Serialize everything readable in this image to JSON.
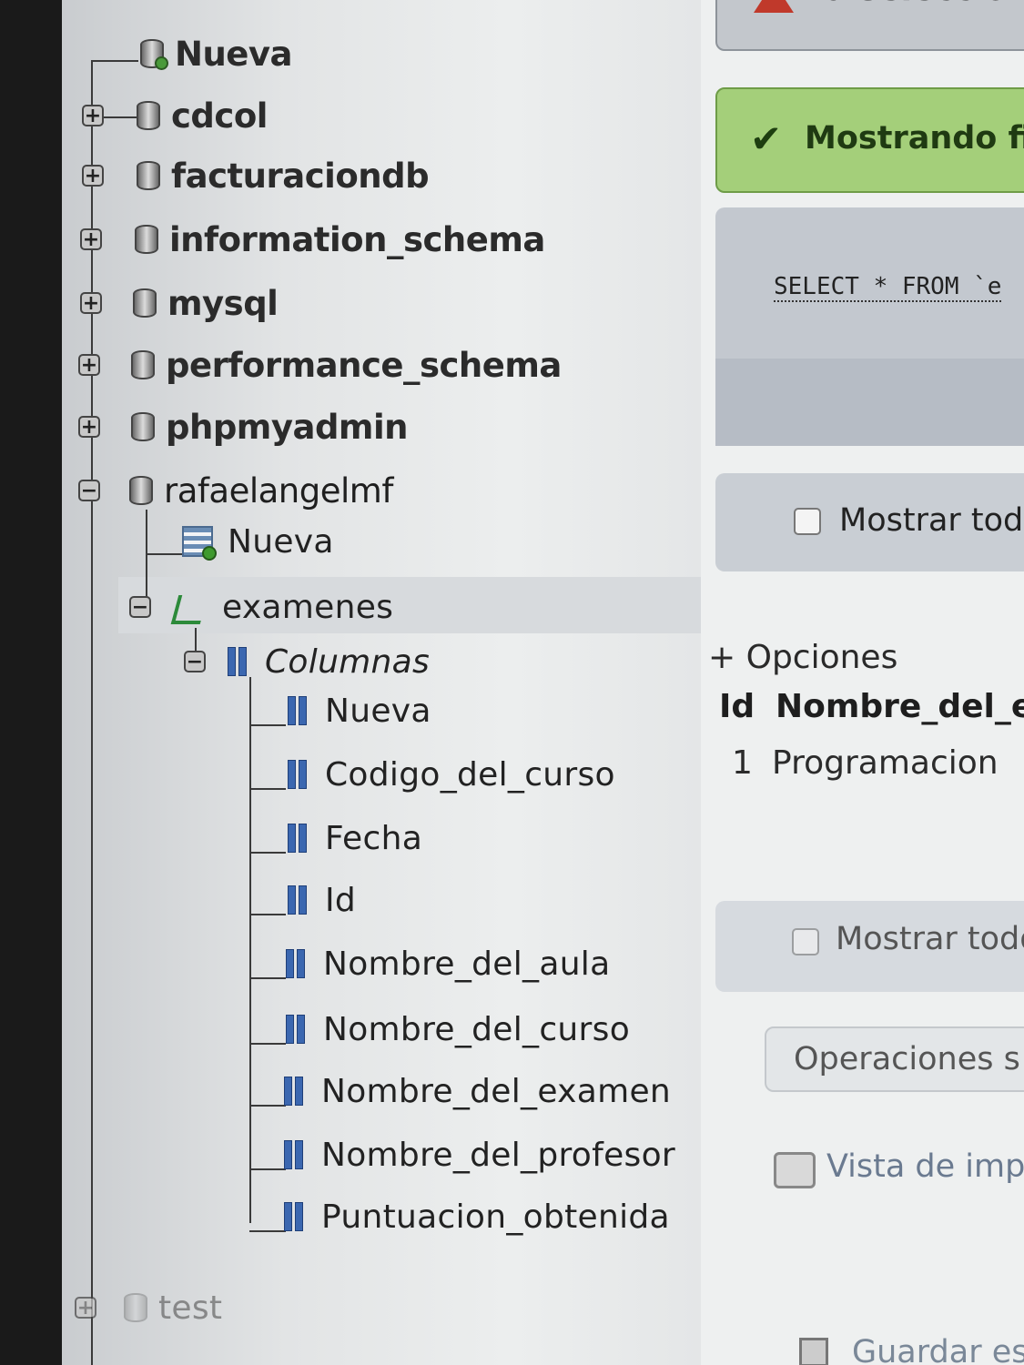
{
  "nav": {
    "databases": [
      {
        "label": "Nueva"
      },
      {
        "label": "cdcol"
      },
      {
        "label": "facturaciondb"
      },
      {
        "label": "information_schema"
      },
      {
        "label": "mysql"
      },
      {
        "label": "performance_schema"
      },
      {
        "label": "phpmyadmin"
      },
      {
        "label": "rafaelangelmf"
      }
    ],
    "expanded_db": {
      "new_table": "Nueva",
      "table": "examenes",
      "columns_group": "Columnas",
      "columns": [
        "Nueva",
        "Codigo_del_curso",
        "Fecha",
        "Id",
        "Nombre_del_aula",
        "Nombre_del_curso",
        "Nombre_del_examen",
        "Nombre_del_profesor",
        "Puntuacion_obtenida"
      ]
    },
    "last_db": "test"
  },
  "main": {
    "warning_text": "La selección a",
    "success_text": "Mostrando filas",
    "sql_text": "SELECT * FROM `e",
    "show_all_1": "Mostrar todo",
    "options_link": "+ Opciones",
    "results": {
      "headers": [
        "Id",
        "Nombre_del_e"
      ],
      "rows": [
        [
          "1",
          "Programacion"
        ]
      ]
    },
    "show_all_2": "Mostrar todo",
    "operations_text": "Operaciones s",
    "print_view": "Vista de impr",
    "save_text": "Guardar es"
  },
  "colors": {
    "success_bg": "#a4cf7a",
    "warning_icon": "#c0392b",
    "column_icon": "#3b67b0"
  }
}
